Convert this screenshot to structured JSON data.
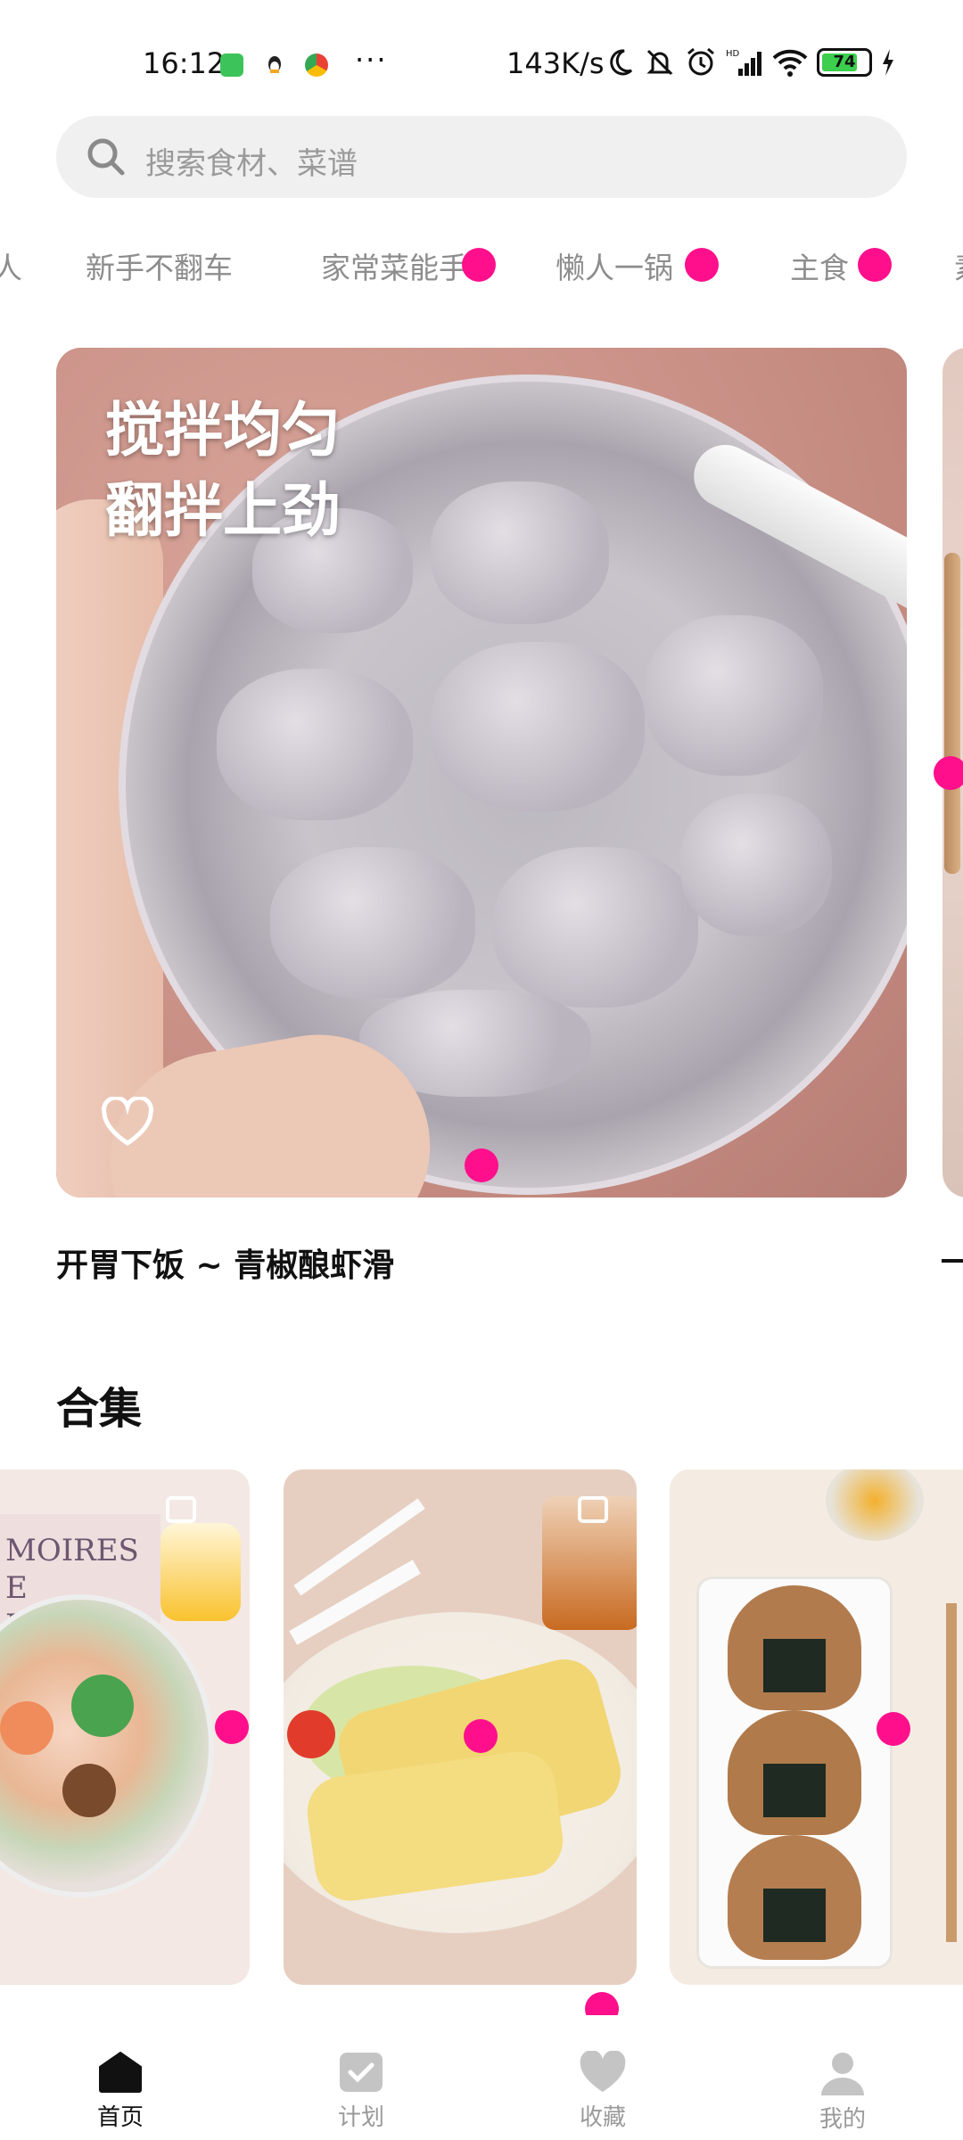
{
  "status_bar": {
    "time": "16:12",
    "network_speed": "143K/s",
    "battery_level": "74",
    "icons": [
      "app-icon-green",
      "qq-icon",
      "chrome-icon",
      "moon-icon",
      "mute-bell-icon",
      "alarm-icon",
      "hd-signal-icon",
      "wifi-icon",
      "battery-icon",
      "charging-icon"
    ],
    "more": "···"
  },
  "search": {
    "placeholder": "搜索食材、菜谱"
  },
  "category_tabs": [
    "人",
    "新手不翻车",
    "家常菜能手",
    "懒人一锅",
    "主食",
    "素"
  ],
  "featured": {
    "caption_line1": "搅拌均匀",
    "caption_line2": "翻拌上劲",
    "title": "开胃下饭 ~ 青椒酿虾滑",
    "favorite_icon": "heart-outline-icon"
  },
  "collections_section": {
    "title": "合集",
    "cards": [
      {
        "image": "noodle-soup-photo",
        "poster_text": "MOIRES\nE\nRIS"
      },
      {
        "image": "shrimp-omelette-photo"
      },
      {
        "image": "rice-ball-photo"
      }
    ]
  },
  "bottom_nav": {
    "items": [
      {
        "label": "首页",
        "icon": "home-icon",
        "active": true
      },
      {
        "label": "计划",
        "icon": "plan-check-icon",
        "active": false
      },
      {
        "label": "收藏",
        "icon": "heart-icon",
        "active": false
      },
      {
        "label": "我的",
        "icon": "person-icon",
        "active": false
      }
    ]
  },
  "colors": {
    "accent_dot": "#ff0f8c",
    "tab_text": "#8d8d8d",
    "battery_fill": "#3ccf4e"
  }
}
